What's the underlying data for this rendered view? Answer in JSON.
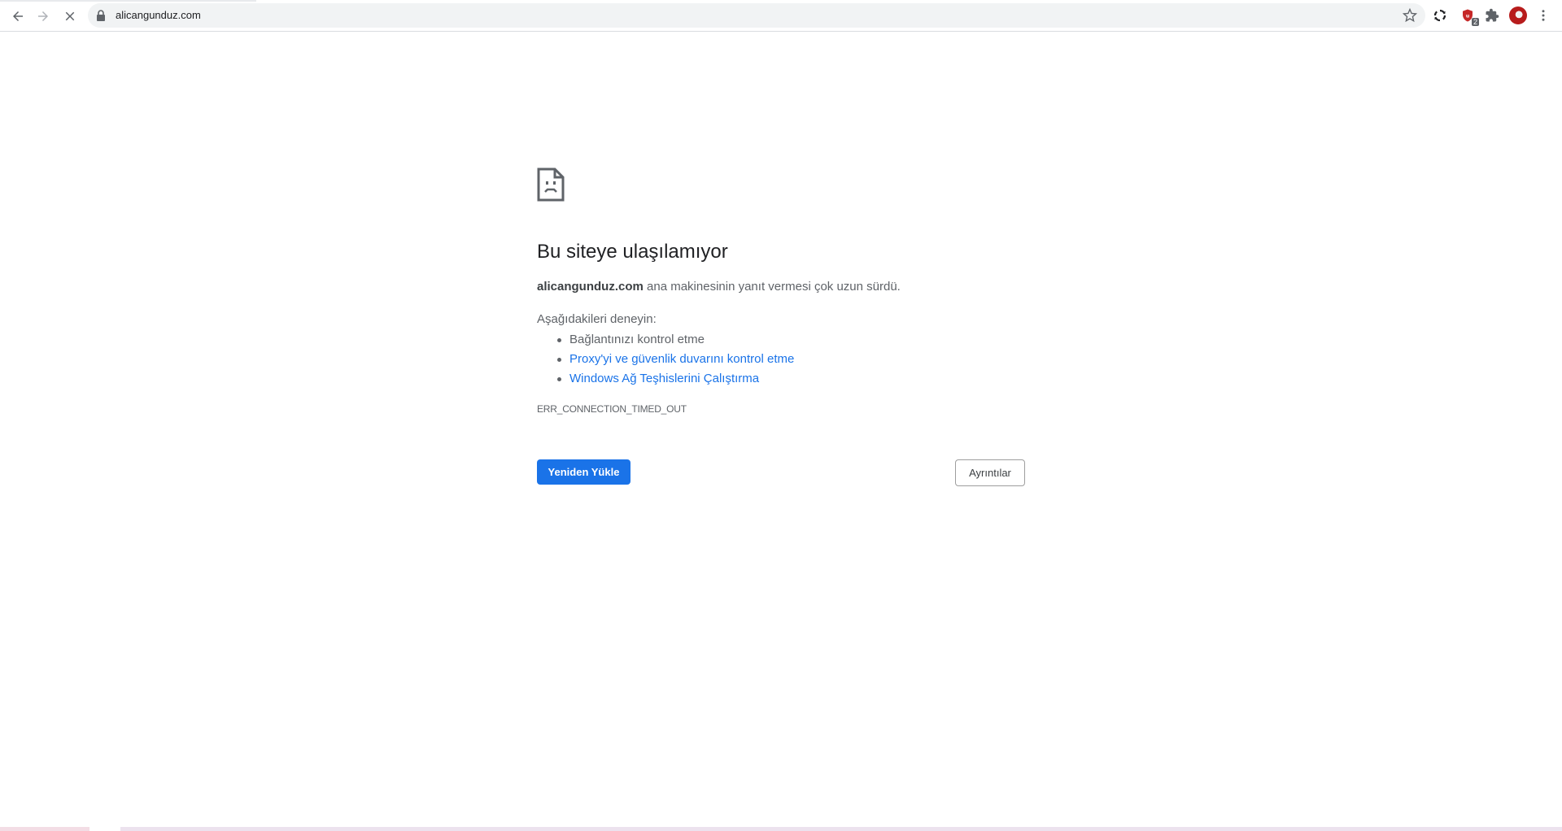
{
  "browser": {
    "url": "alicangunduz.com",
    "icons": {
      "back": "back-arrow-icon",
      "forward": "forward-arrow-icon",
      "stop": "stop-loading-icon",
      "lock": "lock-icon",
      "bookmark": "star-icon",
      "extension_sync": "sync-extension-icon",
      "extension_shield": "shield-extension-icon",
      "extensions": "puzzle-icon",
      "menu": "more-vertical-icon"
    },
    "extension_badge": "2"
  },
  "error_page": {
    "title": "Bu siteye ulaşılamıyor",
    "host": "alicangunduz.com",
    "message": " ana makinesinin yanıt vermesi çok uzun sürdü.",
    "try_label": "Aşağıdakileri deneyin:",
    "suggestions": [
      "Bağlantınızı kontrol etme",
      "Proxy'yi ve güvenlik duvarını kontrol etme",
      "Windows Ağ Teşhislerini Çalıştırma"
    ],
    "error_code": "ERR_CONNECTION_TIMED_OUT",
    "reload_button": "Yeniden Yükle",
    "details_button": "Ayrıntılar"
  },
  "colors": {
    "accent": "#1a73e8",
    "text_primary": "#202124",
    "text_secondary": "#5f6368"
  }
}
